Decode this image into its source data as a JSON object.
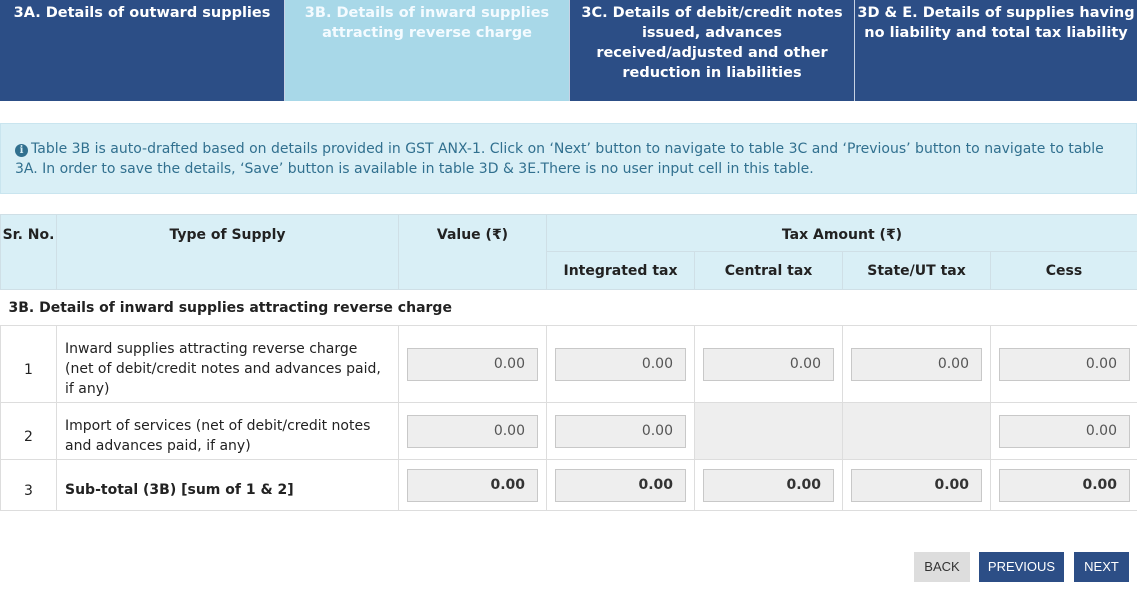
{
  "tabs": [
    {
      "label": "3A. Details of outward supplies",
      "active": false
    },
    {
      "label": "3B. Details of inward supplies attracting reverse charge",
      "active": true
    },
    {
      "label": "3C. Details of debit/credit notes issued, advances received/adjusted and other reduction in liabilities",
      "active": false
    },
    {
      "label": "3D & E. Details of supplies having no liability and total tax liability",
      "active": false
    }
  ],
  "info": {
    "icon": "info-icon",
    "text": "Table 3B is auto-drafted based on details provided in GST ANX-1. Click on ‘Next’ button to navigate to table 3C and ‘Previous’ button to navigate to table 3A. In order to save the details, ‘Save’ button is available in table 3D & 3E.There is no user input cell in this table."
  },
  "table": {
    "headers": {
      "sr": "Sr. No.",
      "type": "Type of Supply",
      "value": "Value (₹)",
      "tax_amount": "Tax Amount (₹)",
      "igst": "Integrated tax",
      "cgst": "Central tax",
      "sgst": "State/UT tax",
      "cess": "Cess"
    },
    "section_title": "3B. Details of inward supplies attracting reverse charge",
    "rows": [
      {
        "sr": "1",
        "type": "Inward supplies attracting reverse charge (net of debit/credit notes and advances paid, if any)",
        "value": "0.00",
        "igst": "0.00",
        "cgst": "0.00",
        "sgst": "0.00",
        "cess": "0.00"
      },
      {
        "sr": "2",
        "type": "Import of services (net of debit/credit notes and advances paid, if any)",
        "value": "0.00",
        "igst": "0.00",
        "cess": "0.00"
      },
      {
        "sr": "3",
        "type": "Sub-total (3B) [sum of 1 & 2]",
        "value": "0.00",
        "igst": "0.00",
        "cgst": "0.00",
        "sgst": "0.00",
        "cess": "0.00"
      }
    ]
  },
  "buttons": {
    "back": "BACK",
    "previous": "PREVIOUS",
    "next": "NEXT"
  },
  "colors": {
    "tab_bg": "#2c4e86",
    "tab_active_bg": "#a8d8e8",
    "info_bg": "#d9eff6",
    "info_text": "#31708f",
    "header_bg": "#d9eff6"
  }
}
